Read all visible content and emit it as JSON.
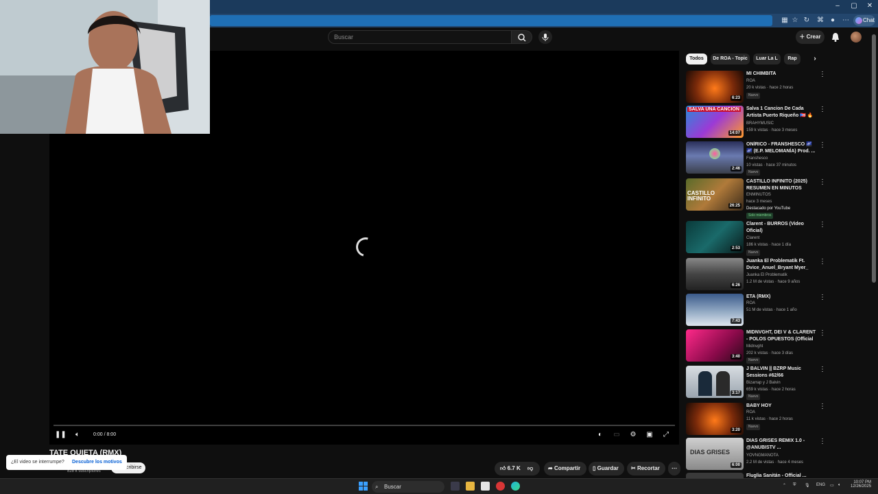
{
  "browser": {
    "chat_label": "Chat",
    "window_controls": [
      "–",
      "▢",
      "✕"
    ]
  },
  "header": {
    "search_placeholder": "Buscar",
    "create_label": "Crear"
  },
  "player": {
    "time": "0:00 / 8:00",
    "progress": 0
  },
  "video": {
    "title": "TATE QUIETA (RMX)",
    "subscribers": "828 k suscriptores",
    "subscribe_label": "cribirse",
    "interrupt_question": "¿El video se interrumpe?",
    "interrupt_link": "Descubre los motivos",
    "likes": "6.7 K",
    "share_label": "Compartir",
    "save_label": "Guardar",
    "clip_label": "Recortar"
  },
  "chips": [
    "Todos",
    "De ROA - Topic",
    "Luar La L",
    "Rap"
  ],
  "recommendations": [
    {
      "title": "MI CHIMBITA",
      "channel": "ROA",
      "meta": "20 k vistas · hace 2 horas",
      "badge": "Nuevo",
      "duration": "6:23"
    },
    {
      "title": "Salva 1 Cancion De Cada Artista Puerto Riqueño 🇵🇷 🔥 💎 ...",
      "channel": "BRAHYMUSIC",
      "meta": "159 k vistas · hace 3 meses",
      "duration": "14:07",
      "thumb_text": "SALVA UNA CANCION"
    },
    {
      "title": "ONÍRICO - FRANSHESCO 🌌🌌 (E.P. MELOMANÍA) Prod. ...",
      "channel": "Franshesco",
      "meta": "10 vistas · hace 37 minutos",
      "badge": "Nuevo",
      "duration": "2:46"
    },
    {
      "title": "CASTILLO INFINITO (2025) RESUMEN EN MINUTOS",
      "channel": "ENMINUTOS",
      "meta": "hace 3 meses",
      "extra": "Destacado por YouTube",
      "members": "Solo miembros",
      "duration": "26:25",
      "thumb_text": "CASTILLO INFINITO"
    },
    {
      "title": "Clarent - BURROS (Video Oficial)",
      "channel": "Clarent",
      "meta": "186 k vistas · hace 1 día",
      "badge": "Nuevo",
      "duration": "2:53"
    },
    {
      "title": "Juanka El Problematik Ft. Dvice_Anuel_Bryant Myer_ Lya...",
      "channel": "Juanka El Problematik",
      "meta": "1.2 M de vistas · hace 9 años",
      "duration": "6:26"
    },
    {
      "title": "ETA (RMX)",
      "channel": "ROA",
      "meta": "51 M de vistas · hace 1 año",
      "duration": "7:43"
    },
    {
      "title": "MIDNVGHT, DEI V & CLARENT - POLOS OPUESTOS (Official ...",
      "channel": "Midnvght",
      "meta": "202 k vistas · hace 3 días",
      "badge": "Nuevo",
      "duration": "3:40"
    },
    {
      "title": "J BALVIN || BZRP Music Sessions #62/66",
      "channel": "Bizarrap y J Balvin",
      "meta": "659 k vistas · hace 2 horas",
      "badge": "Nuevo",
      "duration": "3:17"
    },
    {
      "title": "BABY HOY",
      "channel": "ROA",
      "meta": "11 k vistas · hace 2 horas",
      "badge": "Nuevo",
      "duration": "3:20"
    },
    {
      "title": "DIAS GRISES REMIX 1.0 - @ANUBISTV ...",
      "channel": "YOVNGMANOTA",
      "meta": "2.2 M de vistas · hace 4 meses",
      "duration": "6:00",
      "thumb_text": "DIAS GRISES"
    },
    {
      "title": "Fluglia Sanitán - Official ...",
      "channel": "",
      "meta": ""
    }
  ],
  "taskbar": {
    "search_label": "Buscar",
    "lang": "ENG",
    "time": "10:07 PM",
    "date": "12/26/2025"
  },
  "colors": {
    "background": "#0f0f0f",
    "chip_active": "#f1f1f1",
    "browser_titlebar": "#1b3a5c",
    "address_highlight": "#1f6fb5"
  }
}
